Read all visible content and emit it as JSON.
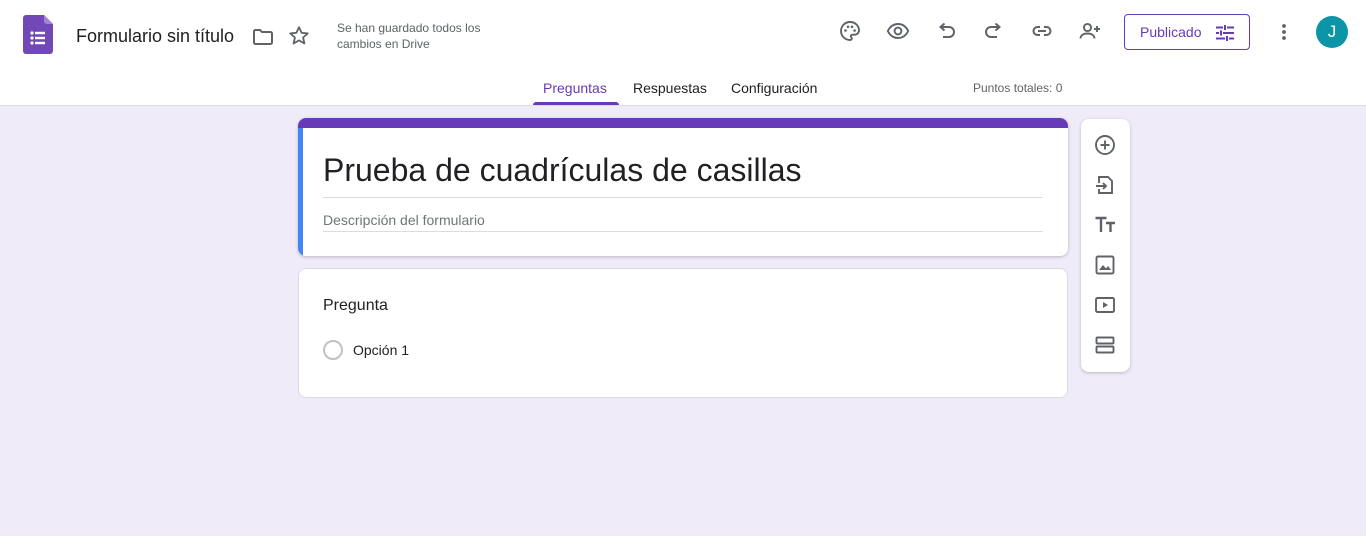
{
  "header": {
    "title": "Formulario sin título",
    "save_status": "Se han guardado todos los cambios en Drive",
    "publish_label": "Publicado",
    "avatar_letter": "J",
    "toolbar_icons": [
      "palette-icon",
      "preview-icon",
      "undo-icon",
      "redo-icon",
      "link-icon",
      "add-collaborator-icon"
    ]
  },
  "tabs": [
    {
      "label": "Preguntas",
      "active": true
    },
    {
      "label": "Respuestas",
      "active": false
    },
    {
      "label": "Configuración",
      "active": false
    }
  ],
  "points_label": "Puntos totales: 0",
  "form": {
    "title": "Prueba de cuadrículas de casillas",
    "description_placeholder": "Descripción del formulario"
  },
  "question": {
    "title": "Pregunta",
    "options": [
      "Opción 1"
    ]
  },
  "side_tools": [
    "add-question-icon",
    "import-questions-icon",
    "add-title-icon",
    "add-image-icon",
    "add-video-icon",
    "add-section-icon"
  ],
  "colors": {
    "accent": "#673ab7",
    "background": "#efebf9",
    "title_card_sidebar": "#4285f4",
    "avatar": "#0b95a6"
  }
}
